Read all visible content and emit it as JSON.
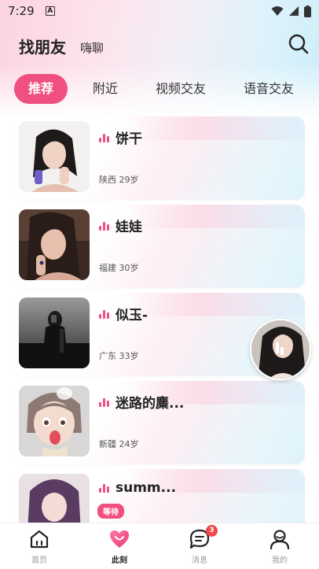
{
  "status_bar": {
    "time": "7:29",
    "notification_letter": "A"
  },
  "header": {
    "title": "找朋友",
    "subtitle": "嗨聊"
  },
  "tabs": [
    {
      "label": "推荐",
      "active": true
    },
    {
      "label": "附近",
      "active": false
    },
    {
      "label": "视频交友",
      "active": false
    },
    {
      "label": "语音交友",
      "active": false
    }
  ],
  "users": [
    {
      "name": "饼干",
      "meta": "陕西 29岁"
    },
    {
      "name": "娃娃",
      "meta": "福建 30岁"
    },
    {
      "name": "似玉-",
      "meta": "广东 33岁"
    },
    {
      "name": "迷路的麋...",
      "meta": "新疆 24岁"
    },
    {
      "name": "summ...",
      "badge": "等待"
    }
  ],
  "bottom_nav": [
    {
      "label": "首页",
      "icon": "home-icon",
      "active": false
    },
    {
      "label": "此刻",
      "icon": "heart-icon",
      "active": true
    },
    {
      "label": "消息",
      "icon": "message-icon",
      "active": false,
      "badge": "3"
    },
    {
      "label": "我的",
      "icon": "profile-icon",
      "active": false
    }
  ],
  "colors": {
    "accent": "#f0507f",
    "badge": "#f04848"
  }
}
